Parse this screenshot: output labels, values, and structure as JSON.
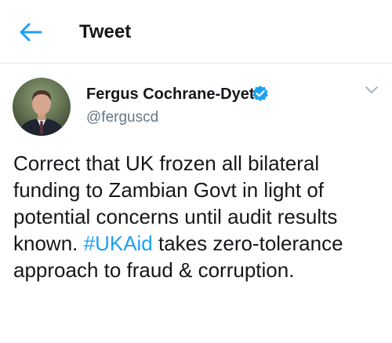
{
  "header": {
    "title": "Tweet",
    "back_icon": "arrow-left-icon",
    "accent_color": "#1da1f2"
  },
  "tweet": {
    "author_name": "Fergus Cochrane-Dyet",
    "verified": true,
    "verified_icon": "verified-badge-icon",
    "handle": "@ferguscd",
    "menu_icon": "chevron-down-icon",
    "text_before": "Correct that UK frozen all bilateral funding to Zambian Govt in light of potential concerns until audit results known. ",
    "hashtag": "#UKAid",
    "text_after": " takes zero-tolerance approach to fraud & corruption."
  }
}
